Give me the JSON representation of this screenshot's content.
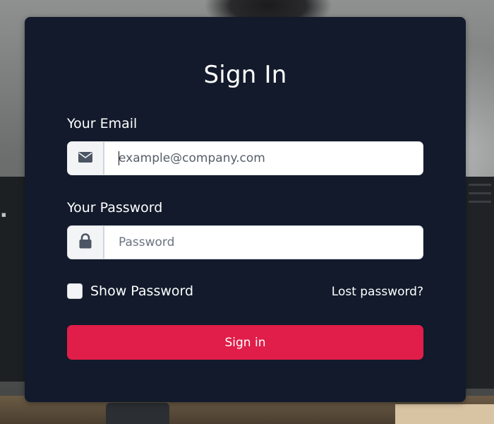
{
  "form": {
    "title": "Sign In",
    "email_label": "Your Email",
    "email_placeholder": "example@company.com",
    "email_value": "",
    "email_icon": "envelope-icon",
    "password_label": "Your Password",
    "password_placeholder": "Password",
    "password_value": "",
    "password_icon": "lock-icon",
    "show_password_label": "Show Password",
    "show_password_checked": false,
    "lost_password_link": "Lost password?",
    "submit_label": "Sign in"
  },
  "colors": {
    "card_bg": "#121a2b",
    "primary_button": "#e01e49",
    "input_addon_bg": "#f3f4f6"
  }
}
